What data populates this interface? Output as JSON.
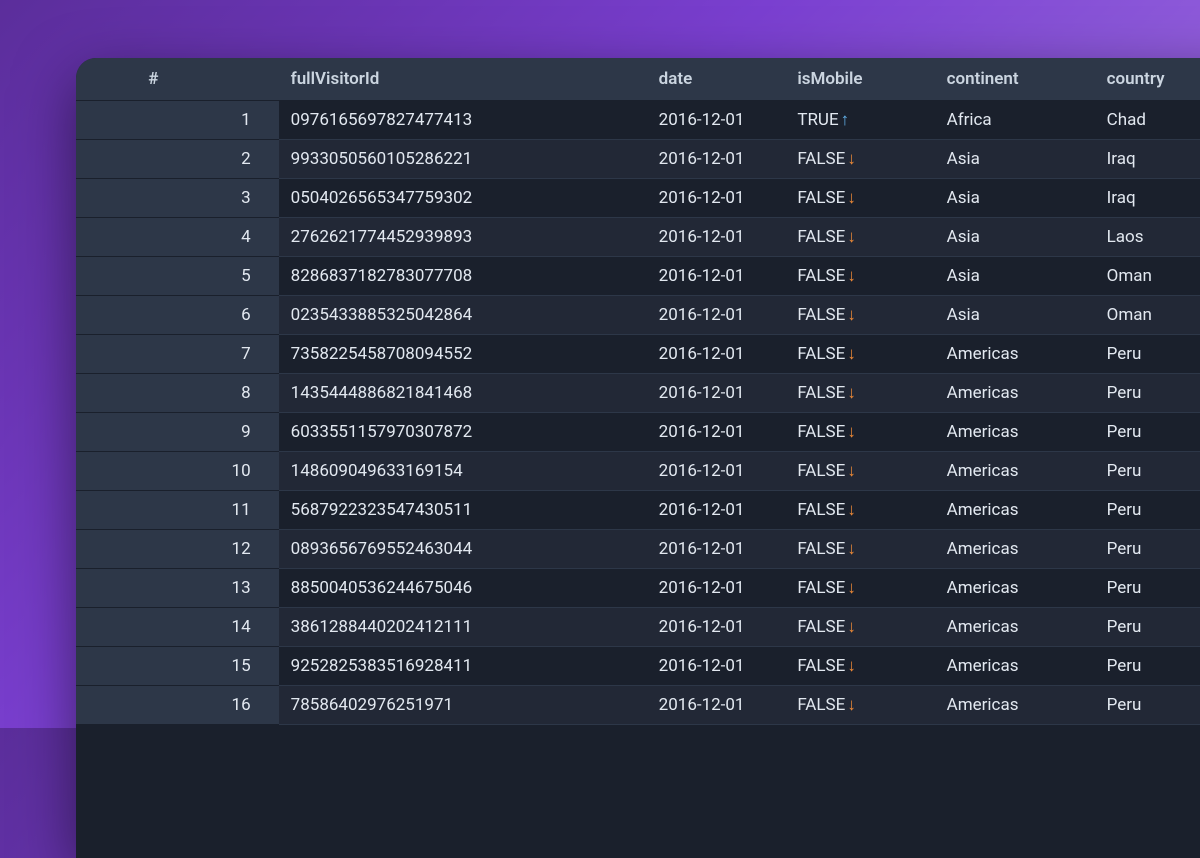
{
  "table": {
    "headers": {
      "index": "#",
      "fullVisitorId": "fullVisitorId",
      "date": "date",
      "isMobile": "isMobile",
      "continent": "continent",
      "country": "country"
    },
    "rows": [
      {
        "index": "1",
        "fullVisitorId": "0976165697827477413",
        "date": "2016-12-01",
        "isMobile": "TRUE",
        "arrow": "up",
        "continent": "Africa",
        "country": "Chad"
      },
      {
        "index": "2",
        "fullVisitorId": "9933050560105286221",
        "date": "2016-12-01",
        "isMobile": "FALSE",
        "arrow": "down",
        "continent": "Asia",
        "country": "Iraq"
      },
      {
        "index": "3",
        "fullVisitorId": "0504026565347759302",
        "date": "2016-12-01",
        "isMobile": "FALSE",
        "arrow": "down",
        "continent": "Asia",
        "country": "Iraq"
      },
      {
        "index": "4",
        "fullVisitorId": "2762621774452939893",
        "date": "2016-12-01",
        "isMobile": "FALSE",
        "arrow": "down",
        "continent": "Asia",
        "country": "Laos"
      },
      {
        "index": "5",
        "fullVisitorId": "8286837182783077708",
        "date": "2016-12-01",
        "isMobile": "FALSE",
        "arrow": "down",
        "continent": "Asia",
        "country": "Oman"
      },
      {
        "index": "6",
        "fullVisitorId": "0235433885325042864",
        "date": "2016-12-01",
        "isMobile": "FALSE",
        "arrow": "down",
        "continent": "Asia",
        "country": "Oman"
      },
      {
        "index": "7",
        "fullVisitorId": "7358225458708094552",
        "date": "2016-12-01",
        "isMobile": "FALSE",
        "arrow": "down",
        "continent": "Americas",
        "country": "Peru"
      },
      {
        "index": "8",
        "fullVisitorId": "1435444886821841468",
        "date": "2016-12-01",
        "isMobile": "FALSE",
        "arrow": "down",
        "continent": "Americas",
        "country": "Peru"
      },
      {
        "index": "9",
        "fullVisitorId": "6033551157970307872",
        "date": "2016-12-01",
        "isMobile": "FALSE",
        "arrow": "down",
        "continent": "Americas",
        "country": "Peru"
      },
      {
        "index": "10",
        "fullVisitorId": "148609049633169154",
        "date": "2016-12-01",
        "isMobile": "FALSE",
        "arrow": "down",
        "continent": "Americas",
        "country": "Peru"
      },
      {
        "index": "11",
        "fullVisitorId": "5687922323547430511",
        "date": "2016-12-01",
        "isMobile": "FALSE",
        "arrow": "down",
        "continent": "Americas",
        "country": "Peru"
      },
      {
        "index": "12",
        "fullVisitorId": "0893656769552463044",
        "date": "2016-12-01",
        "isMobile": "FALSE",
        "arrow": "down",
        "continent": "Americas",
        "country": "Peru"
      },
      {
        "index": "13",
        "fullVisitorId": "8850040536244675046",
        "date": "2016-12-01",
        "isMobile": "FALSE",
        "arrow": "down",
        "continent": "Americas",
        "country": "Peru"
      },
      {
        "index": "14",
        "fullVisitorId": "3861288440202412111",
        "date": "2016-12-01",
        "isMobile": "FALSE",
        "arrow": "down",
        "continent": "Americas",
        "country": "Peru"
      },
      {
        "index": "15",
        "fullVisitorId": "9252825383516928411",
        "date": "2016-12-01",
        "isMobile": "FALSE",
        "arrow": "down",
        "continent": "Americas",
        "country": "Peru"
      },
      {
        "index": "16",
        "fullVisitorId": "78586402976251971",
        "date": "2016-12-01",
        "isMobile": "FALSE",
        "arrow": "down",
        "continent": "Americas",
        "country": "Peru"
      }
    ]
  },
  "arrows": {
    "up": "↑",
    "down": "↓"
  }
}
